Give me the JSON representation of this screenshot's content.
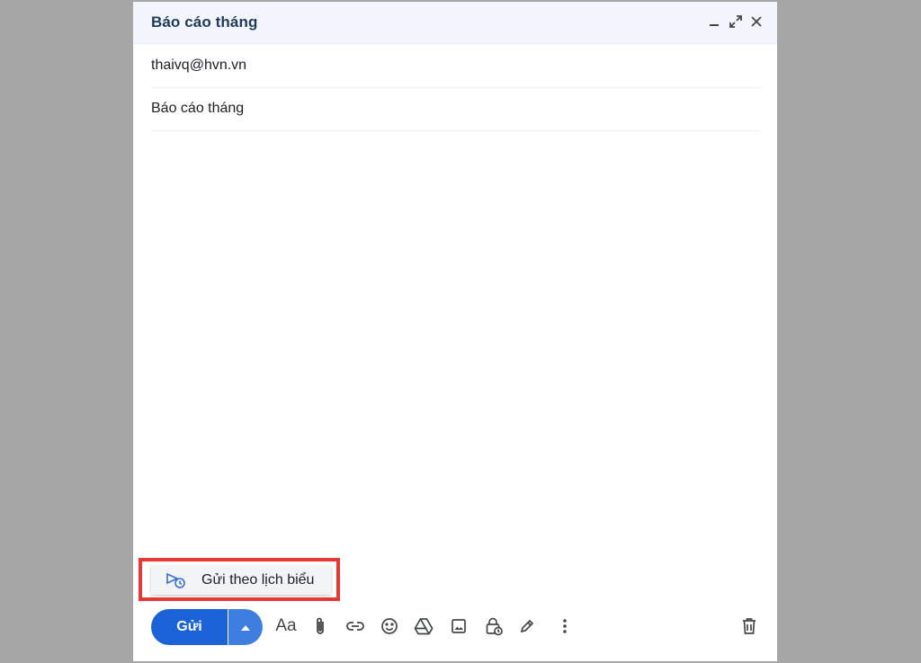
{
  "compose": {
    "title": "Báo cáo tháng",
    "recipient": "thaivq@hvn.vn",
    "subject": "Báo cáo tháng"
  },
  "header_icons": [
    "minimize-icon",
    "expand-icon",
    "close-icon"
  ],
  "schedule_menu": {
    "label": "Gửi theo lịch biểu",
    "icon": "schedule-send-icon"
  },
  "toolbar": {
    "send_label": "Gửi",
    "format_label": "Aa",
    "icons": [
      "dropdown-arrow-icon",
      "formatting-icon",
      "attach-icon",
      "link-icon",
      "emoji-icon",
      "drive-icon",
      "photo-icon",
      "confidential-icon",
      "signature-icon",
      "more-options-icon",
      "trash-icon"
    ]
  },
  "colors": {
    "primary": "#1a62d6",
    "highlight_border": "#e53935",
    "header_bg": "#f2f6fc",
    "backdrop": "#a6a6a6"
  }
}
